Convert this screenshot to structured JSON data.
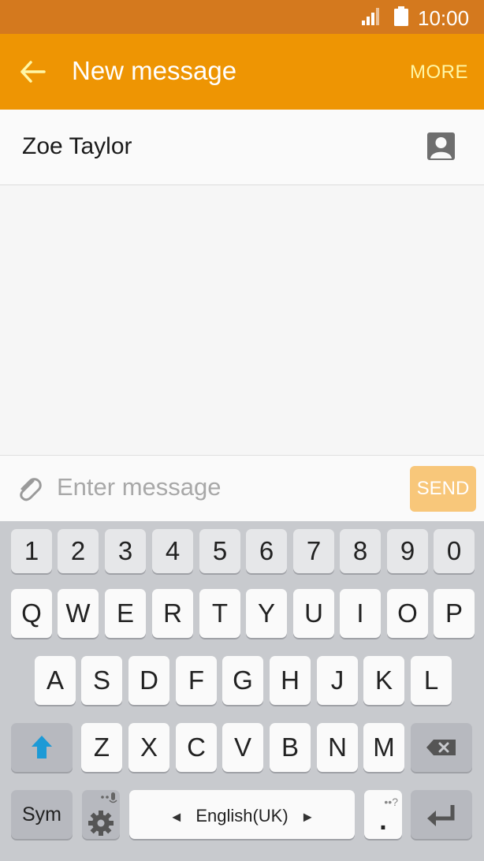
{
  "status_bar": {
    "time": "10:00",
    "signal_icon": "signal-icon",
    "battery_icon": "battery-icon"
  },
  "app_bar": {
    "title": "New message",
    "more_label": "MORE",
    "back_icon": "arrow-left-icon"
  },
  "recipient": {
    "name": "Zoe Taylor",
    "contact_icon": "contact-icon"
  },
  "composer": {
    "placeholder": "Enter message",
    "send_label": "SEND",
    "attach_icon": "paperclip-icon"
  },
  "keyboard": {
    "numbers": [
      "1",
      "2",
      "3",
      "4",
      "5",
      "6",
      "7",
      "8",
      "9",
      "0"
    ],
    "row1": [
      "Q",
      "W",
      "E",
      "R",
      "T",
      "Y",
      "U",
      "I",
      "O",
      "P"
    ],
    "row2": [
      "A",
      "S",
      "D",
      "F",
      "G",
      "H",
      "J",
      "K",
      "L"
    ],
    "row3": [
      "Z",
      "X",
      "C",
      "V",
      "B",
      "N",
      "M"
    ],
    "sym_label": "Sym",
    "space_label": "English(UK)",
    "period_label": ".",
    "period_hint": "••?"
  },
  "colors": {
    "status_bar": "#d4791e",
    "app_bar": "#ee9503",
    "send_disabled": "#f8c77a",
    "shift_accent": "#1c9ad6"
  }
}
